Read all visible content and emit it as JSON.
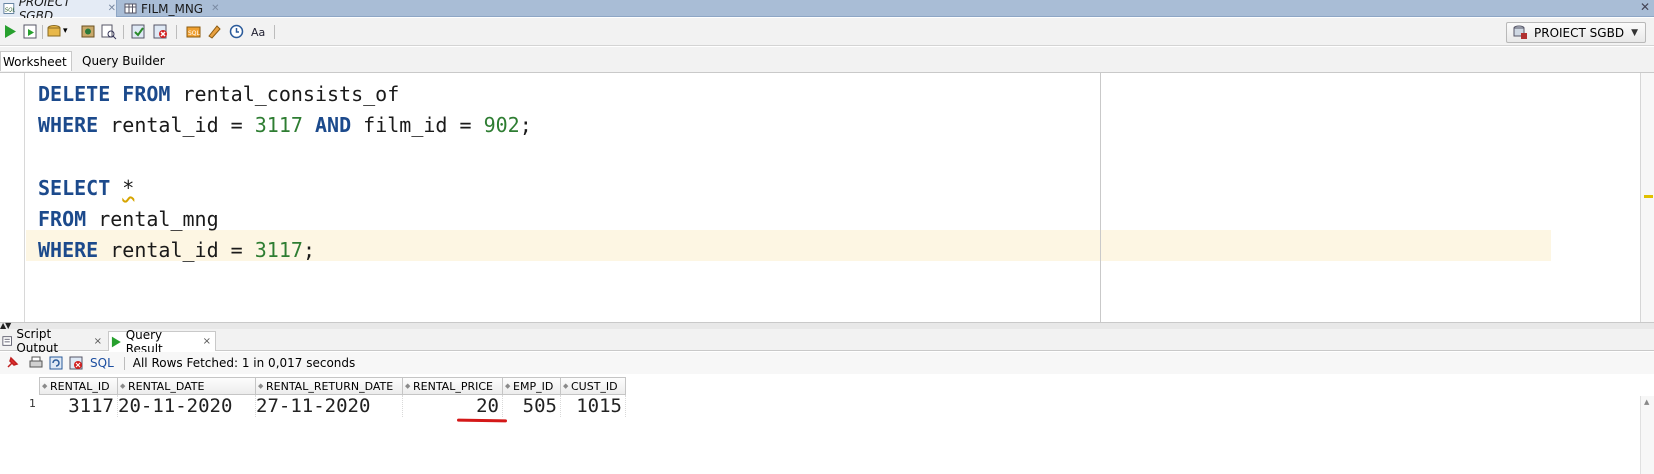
{
  "document_tabs": [
    {
      "label": "PROIECT SGBD",
      "active": true,
      "icon": "sql-worksheet-icon"
    },
    {
      "label": "FILM_MNG",
      "active": false,
      "icon": "table-icon"
    }
  ],
  "window_close": "✕",
  "toolbar": {
    "icons": [
      "run-statement-icon",
      "run-script-icon",
      "commit-icon",
      "rollback-icon",
      "cancel-icon",
      "explain-plan-icon",
      "autotrace-icon",
      "sql-tuning-icon",
      "clear-icon",
      "history-icon",
      "format-icon"
    ],
    "connection": "PROIECT SGBD"
  },
  "editor_tabs": [
    {
      "label": "Worksheet",
      "active": true
    },
    {
      "label": "Query Builder",
      "active": false
    }
  ],
  "editor": {
    "lines": [
      [
        {
          "t": "DELETE",
          "k": "kw"
        },
        {
          "t": " ",
          "k": ""
        },
        {
          "t": "FROM",
          "k": "kw"
        },
        {
          "t": " rental_consists_of",
          "k": ""
        }
      ],
      [
        {
          "t": "WHERE",
          "k": "kw"
        },
        {
          "t": " rental_id = ",
          "k": ""
        },
        {
          "t": "3117",
          "k": "num"
        },
        {
          "t": " ",
          "k": ""
        },
        {
          "t": "AND",
          "k": "kw"
        },
        {
          "t": " film_id = ",
          "k": ""
        },
        {
          "t": "902",
          "k": "num"
        },
        {
          "t": ";",
          "k": ""
        }
      ],
      [],
      [
        {
          "t": "SELECT",
          "k": "kw"
        },
        {
          "t": " ",
          "k": ""
        },
        {
          "t": "*",
          "k": "squig"
        }
      ],
      [
        {
          "t": "FROM",
          "k": "kw"
        },
        {
          "t": " rental_mng",
          "k": ""
        }
      ],
      [
        {
          "t": "WHERE",
          "k": "kw"
        },
        {
          "t": " rental_id = ",
          "k": ""
        },
        {
          "t": "3117",
          "k": "num"
        },
        {
          "t": ";",
          "k": ""
        }
      ]
    ],
    "highlighted_line": 6
  },
  "result_tabs": [
    {
      "label": "Script Output",
      "active": false,
      "close": "×"
    },
    {
      "label": "Query Result",
      "active": true,
      "close": "×"
    }
  ],
  "result_toolbar": {
    "sql_label": "SQL",
    "status": "All Rows Fetched: 1 in 0,017 seconds"
  },
  "grid": {
    "columns": [
      "RENTAL_ID",
      "RENTAL_DATE",
      "RENTAL_RETURN_DATE",
      "RENTAL_PRICE",
      "EMP_ID",
      "CUST_ID"
    ],
    "rows": [
      {
        "num": "1",
        "cells": [
          "3117",
          "20-11-2020",
          "27-11-2020",
          "20",
          "505",
          "1015"
        ]
      }
    ]
  },
  "colors": {
    "keyword": "#1c4a8c",
    "number": "#2e7d32",
    "annotation_underline": "#d41818"
  }
}
